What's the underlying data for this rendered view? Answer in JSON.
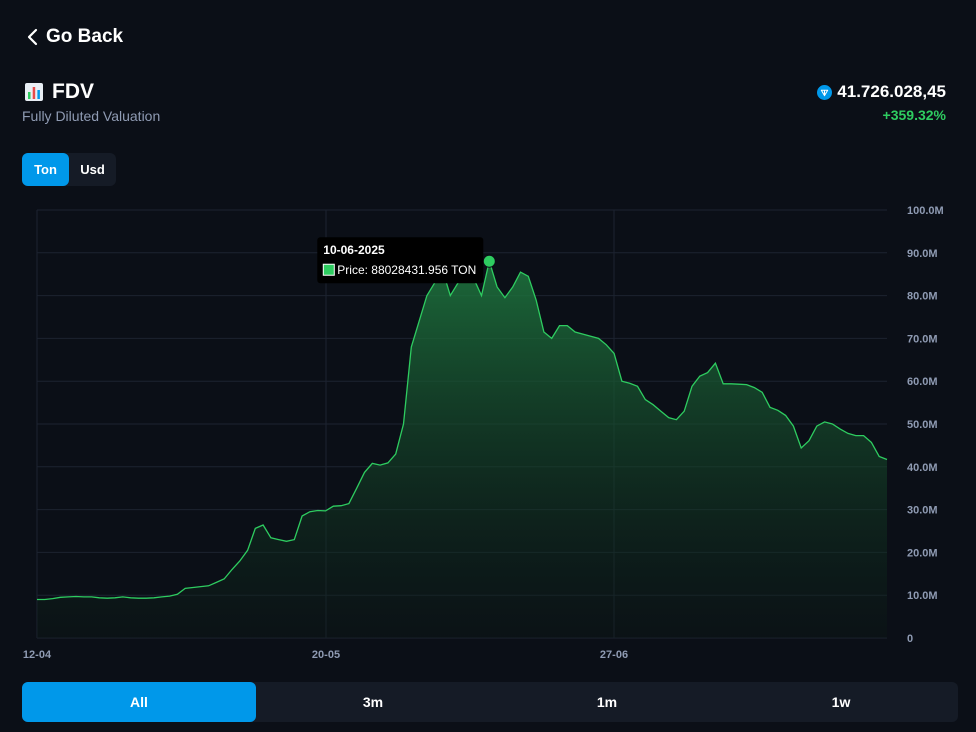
{
  "nav": {
    "back_label": "Go Back"
  },
  "header": {
    "title": "FDV",
    "subtitle": "Fully Diluted Valuation",
    "value": "41.726.028,45",
    "change": "+359.32%",
    "title_icon": "bar-chart-icon",
    "value_icon": "ton-icon"
  },
  "currency": {
    "options": [
      "Ton",
      "Usd"
    ],
    "selected": "Ton"
  },
  "ranges": {
    "options": [
      "All",
      "3m",
      "1m",
      "1w"
    ],
    "selected": "All"
  },
  "colors": {
    "background": "#0b0f17",
    "accent": "#0098ea",
    "line": "#2ecc60",
    "positive": "#2ecc60",
    "muted_text": "#8f9bb3"
  },
  "tooltip": {
    "date": "10-06-2025",
    "price_label": "Price: 88028431.956 TON"
  },
  "chart_data": {
    "type": "area",
    "title": "",
    "xlabel": "",
    "ylabel": "",
    "x_ticks": [
      "12-04",
      "20-05",
      "27-06"
    ],
    "y_ticks": [
      "0",
      "10.0M",
      "20.0M",
      "30.0M",
      "40.0M",
      "50.0M",
      "60.0M",
      "70.0M",
      "80.0M",
      "90.0M",
      "100.0M"
    ],
    "ylim": [
      0,
      100000000
    ],
    "grid": true,
    "highlight_index": 58,
    "series": [
      {
        "values": [
          9000000,
          9000000,
          9200000,
          9500000,
          9600000,
          9700000,
          9600000,
          9600000,
          9400000,
          9300000,
          9400000,
          9600000,
          9400000,
          9300000,
          9300000,
          9400000,
          9600000,
          9800000,
          10200000,
          11600000,
          11800000,
          12000000,
          12200000,
          13000000,
          13800000,
          16000000,
          18000000,
          20500000,
          25600000,
          26400000,
          23400000,
          23000000,
          22600000,
          23000000,
          28500000,
          29500000,
          29800000,
          29700000,
          30800000,
          30900000,
          31400000,
          35000000,
          38700000,
          40800000,
          40400000,
          40900000,
          43000000,
          50000000,
          68000000,
          74000000,
          80000000,
          83000000,
          86000000,
          80000000,
          83000000,
          85200000,
          84000000,
          80000000,
          88028431.956,
          82000000,
          79500000,
          82000000,
          85500000,
          84500000,
          79000000,
          71500000,
          70000000,
          73000000,
          73000000,
          71500000,
          71000000,
          70500000,
          70000000,
          68500000,
          66500000,
          60000000,
          59500000,
          58800000,
          55700000,
          54500000,
          53000000,
          51500000,
          51000000,
          53000000,
          58800000,
          61200000,
          62000000,
          64200000,
          59400000,
          59400000,
          59300000,
          59200000,
          58500000,
          57400000,
          53900000,
          53200000,
          52000000,
          49500000,
          44400000,
          46100000,
          49500000,
          50500000,
          50000000,
          48800000,
          47800000,
          47300000,
          47300000,
          45700000,
          42400000,
          41700000
        ]
      }
    ]
  }
}
